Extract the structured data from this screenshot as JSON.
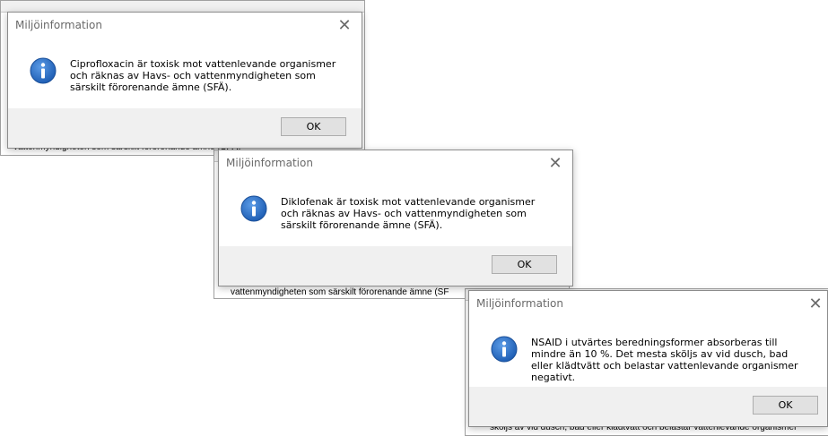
{
  "dialogs": [
    {
      "title": "Miljöinformation",
      "close_glyph": "✕",
      "icon": "info-icon",
      "message": "Ciprofloxacin är toxisk mot vattenlevande organismer och räknas av Havs- och vattenmyndigheten som särskilt förorenande ämne (SFÄ).",
      "ok_label": "OK"
    },
    {
      "title": "Miljöinformation",
      "close_glyph": "✕",
      "icon": "info-icon",
      "message": "Diklofenak är toxisk mot vattenlevande organismer och räknas av Havs- och vattenmyndigheten som särskilt förorenande ämne (SFÄ).",
      "ok_label": "OK"
    },
    {
      "title": "Miljöinformation",
      "close_glyph": "✕",
      "icon": "info-icon",
      "message": "NSAID i utvärtes beredningsformer absorberas till mindre än 10 %. Det mesta sköljs av vid dusch, bad eller klädtvätt och belastar vattenlevande organismer negativt.",
      "ok_label": "OK"
    }
  ],
  "background": {
    "texts": [
      "vattenmyndigheten som särskilt förorenande ämne (SFÄ)",
      "vattenmyndigheten som särskilt förorenande ämne (SF",
      "sköljs av vid dusch, bad eller klädtvätt och belastar vattenlevande organismer"
    ]
  },
  "colors": {
    "dialog_bg": "#ffffff",
    "footer_bg": "#f0f0f0",
    "title_text": "#6a6a6a",
    "button_bg": "#e1e1e1",
    "button_border": "#adadad",
    "icon_blue": "#1f5fb5"
  }
}
